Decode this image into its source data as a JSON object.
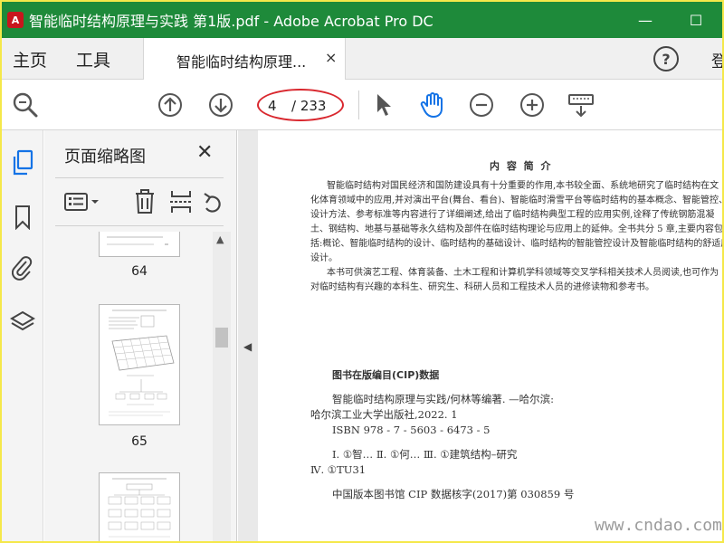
{
  "window": {
    "title": "智能临时结构原理与实践 第1版.pdf - Adobe Acrobat Pro DC",
    "app_icon_glyph": "A",
    "minimize_glyph": "—",
    "maximize_glyph": "☐"
  },
  "tabs": {
    "home": "主页",
    "tools": "工具",
    "document": "智能临时结构原理...",
    "close_glyph": "×",
    "help_glyph": "?",
    "signin_partial": "登"
  },
  "toolbar": {
    "current_page": "4",
    "total_pages": "/ 233"
  },
  "rail_icons": [
    "page-thumbnails-icon",
    "bookmark-icon",
    "attachment-icon",
    "layers-icon"
  ],
  "panel": {
    "title": "页面缩略图",
    "close_glyph": "✕",
    "thumbnails": [
      {
        "label": "64"
      },
      {
        "label": "65"
      }
    ]
  },
  "document": {
    "heading": "内 容 简 介",
    "summary_lines": [
      "智能临时结构对国民经济和国防建设具有十分重要的作用,本书较全面、系统地研究了临时结构在文",
      "化体育领域中的应用,并对演出平台(舞台、看台)、智能临时滑雪平台等临时结构的基本概念、智能管控、",
      "设计方法、参考标准等内容进行了详细阐述,给出了临时结构典型工程的应用实例,诠释了传统钢筋混凝",
      "土、钢结构、地基与基础等永久结构及部件在临时结构理论与应用上的延伸。全书共分 5 章,主要内容包",
      "括:概论、智能临时结构的设计、临时结构的基础设计、临时结构的智能管控设计及智能临时结构的舒适度",
      "设计。",
      "本书可供演艺工程、体育装备、土木工程和计算机学科领域等交叉学科相关技术人员阅读,也可作为",
      "对临时结构有兴趣的本科生、研究生、科研人员和工程技术人员的进修读物和参考书。"
    ],
    "cip_title": "图书在版编目(CIP)数据",
    "cip_lines": [
      "智能临时结构原理与实践/何林等编著. —哈尔滨:",
      "哈尔滨工业大学出版社,2022. 1",
      "ISBN 978 - 7 - 5603 - 6473 - 5",
      "Ⅰ. ①智…   Ⅱ. ①何…   Ⅲ. ①建筑结构–研究",
      "Ⅳ. ①TU31",
      "中国版本图书馆 CIP 数据核字(2017)第 030859 号"
    ],
    "watermark": "www.cndao.com"
  },
  "colors": {
    "titlebar": "#1e8a3a",
    "annotation_oval": "#d9272e",
    "hand_tool_active": "#1473e6",
    "border_yellow": "#f5e84a"
  }
}
